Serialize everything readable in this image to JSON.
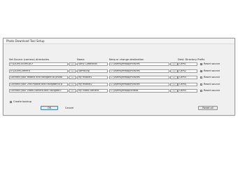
{
  "window": {
    "title": "Photo Download Tool Setup"
  },
  "headers": {
    "source": "Set Source (camera) directories",
    "name": "Name",
    "destination": "Keep or change destination",
    "prefix": "Dest. Directory Prefix"
  },
  "browse_label": "...",
  "rows": [
    {
      "source": "F:\\DCIM\\100MSDCF",
      "name": "Sony Cybershot",
      "destination": "C:\\Users\\jeffapp\\Pictures",
      "prefix": "Cam1",
      "reset_label": "Reset source",
      "reset_checked": true
    },
    {
      "source": "E:\\DCIM\\Camera",
      "name": "Samsung",
      "destination": "C:\\Users\\jeffapp\\Pictures",
      "prefix": "Cam2",
      "reset_label": "Reset source",
      "reset_checked": true
    },
    {
      "source": "Connect your mobile and navigate to photo",
      "name": "My mobile1",
      "destination": "C:\\Users\\jeffapp\\Pictures",
      "prefix": "Cam3",
      "reset_label": "Reset source",
      "reset_checked": false
    },
    {
      "source": "Connect your 2nd mobile and navigate to p",
      "name": "My mobile2",
      "destination": "C:\\Users\\jeffapp\\Pictures",
      "prefix": "Cam4",
      "reset_label": "Reset source",
      "reset_checked": false
    },
    {
      "source": "Connect your video camera and navigate t",
      "name": "My video camera",
      "destination": "C:\\Users\\jeffapp\\Videos",
      "prefix": "Cam5",
      "reset_label": "Reset source",
      "reset_checked": false
    }
  ],
  "backup": {
    "label": "Create backup",
    "checked": false
  },
  "buttons": {
    "ok": "OK",
    "cancel": "Cancel",
    "reset_all": "Reset all"
  }
}
